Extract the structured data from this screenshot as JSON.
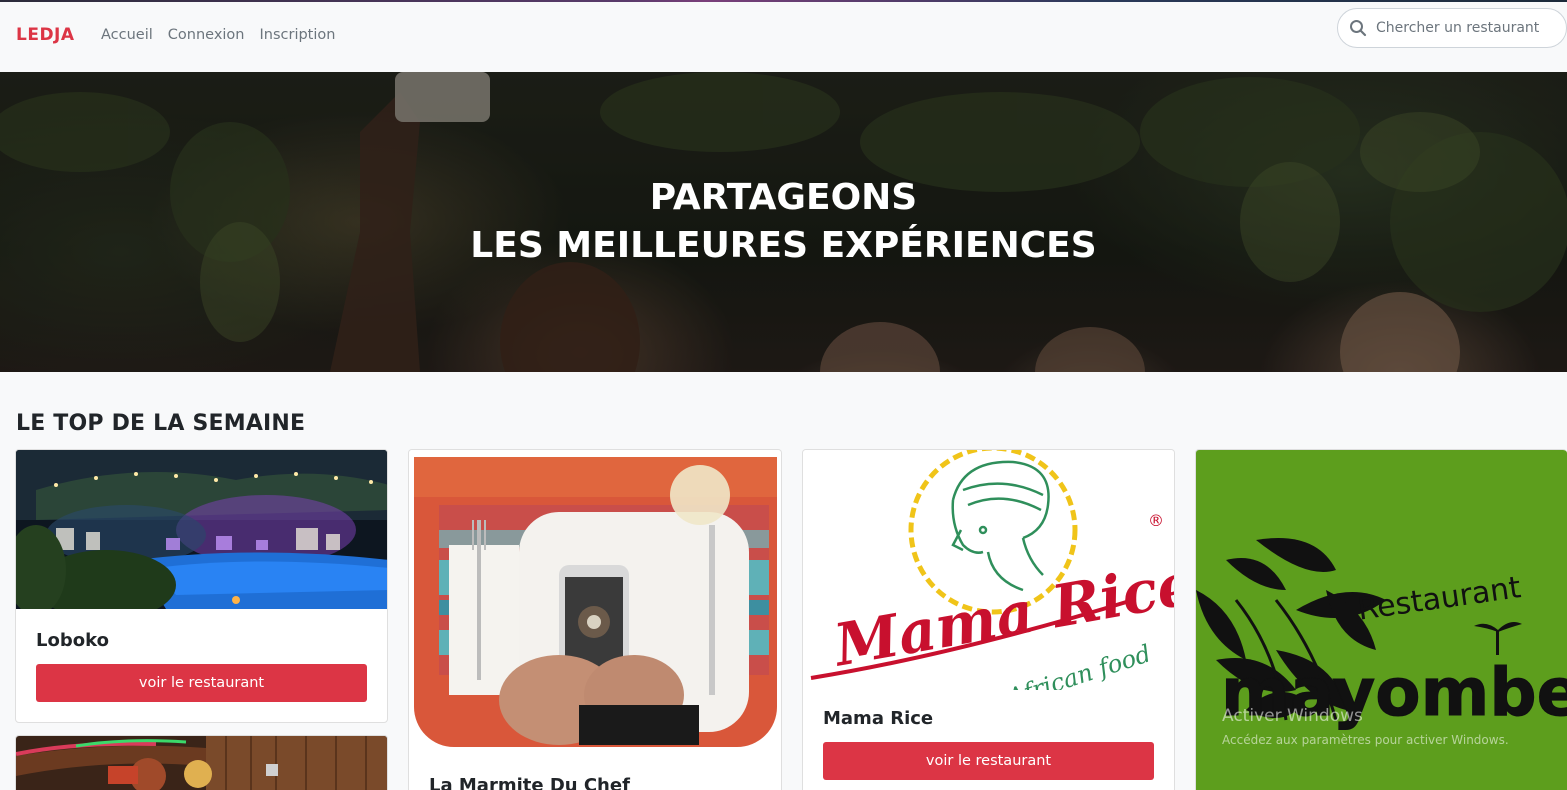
{
  "nav": {
    "brand": "LEDJA",
    "links": [
      "Accueil",
      "Connexion",
      "Inscription"
    ],
    "search_placeholder": "Chercher un restaurant"
  },
  "hero": {
    "line1": "PARTAGEONS",
    "line2": "LES MEILLEURES EXPÉRIENCES"
  },
  "section": {
    "title": "LE TOP DE LA SEMAINE"
  },
  "cards": [
    {
      "name": "Loboko",
      "button": "voir le restaurant"
    },
    {
      "name": "La Marmite Du Chef"
    },
    {
      "name": "Mama Rice",
      "button": "voir le restaurant",
      "logo_main": "Mama Rice",
      "logo_sub": "African food",
      "logo_mark": "®"
    },
    {
      "logo_top": "Restaurant",
      "logo_main": "mayombe"
    }
  ],
  "os_watermark": {
    "line1": "Activer Windows",
    "line2": "Accédez aux paramètres pour activer Windows."
  },
  "colors": {
    "brand": "#dc3545",
    "button": "#dc3545",
    "logo_red": "#c8102e",
    "logo_green": "#2f8f5b",
    "mayombe_bg": "#5d9e1d"
  },
  "icons": {
    "search": "search-icon"
  }
}
